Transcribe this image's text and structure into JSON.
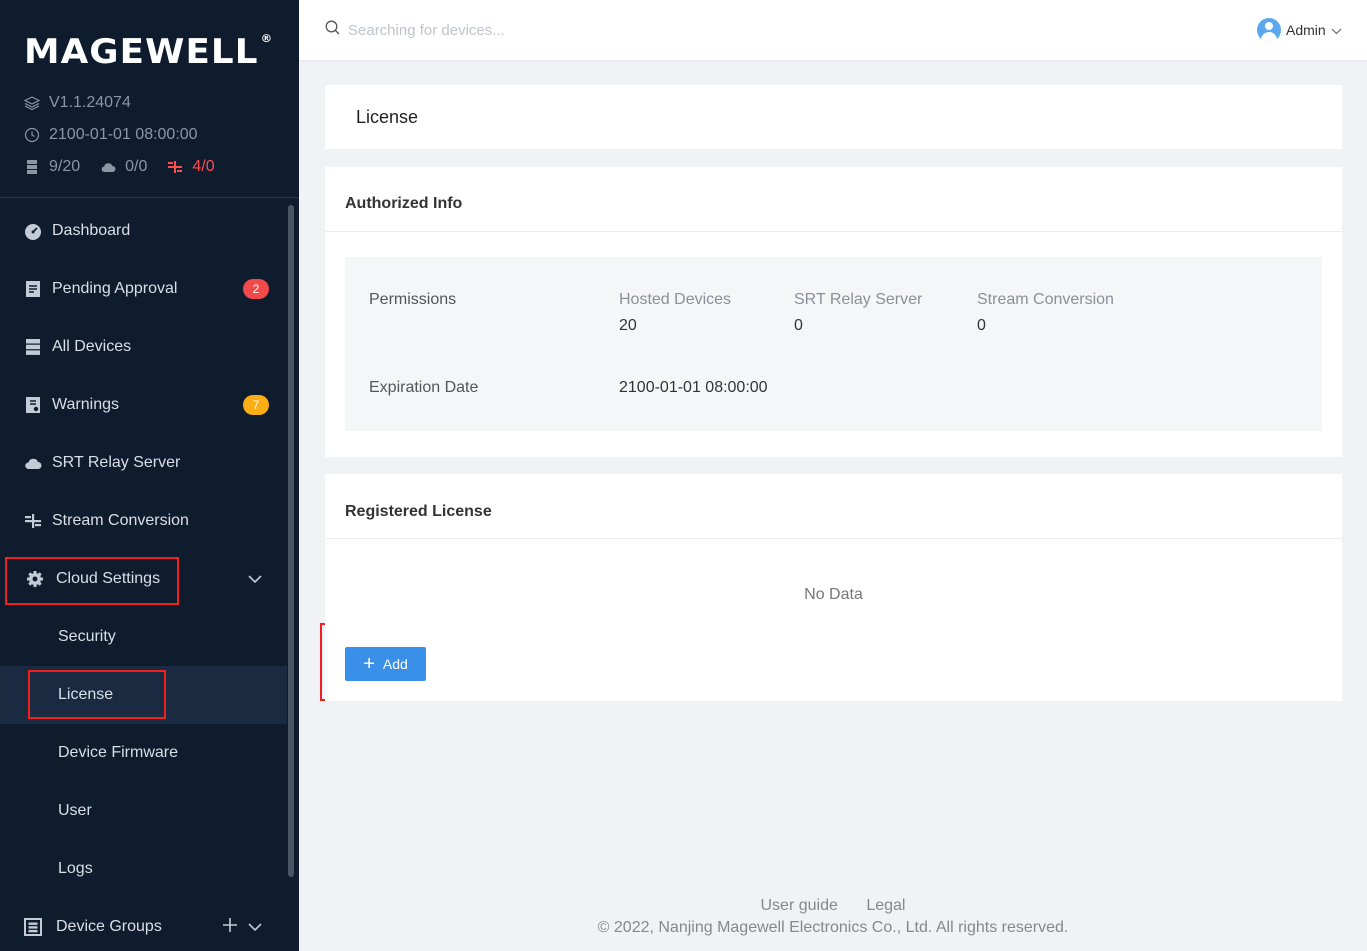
{
  "brand": {
    "logo": "MAGEWELL",
    "reg": "®"
  },
  "meta": {
    "version": "V1.1.24074",
    "datetime": "2100-01-01 08:00:00",
    "devices": "9/20",
    "cloud": "0/0",
    "streams": "4/0"
  },
  "sidebar": {
    "items": [
      {
        "label": "Dashboard"
      },
      {
        "label": "Pending Approval",
        "badge": "2"
      },
      {
        "label": "All Devices"
      },
      {
        "label": "Warnings",
        "badge": "7"
      },
      {
        "label": "SRT Relay Server"
      },
      {
        "label": "Stream Conversion"
      },
      {
        "label": "Cloud Settings"
      }
    ],
    "sub_items": [
      {
        "label": "Security"
      },
      {
        "label": "License"
      },
      {
        "label": "Device Firmware"
      },
      {
        "label": "User"
      },
      {
        "label": "Logs"
      }
    ],
    "groups_label": "Device Groups"
  },
  "header": {
    "search_placeholder": "Searching for devices...",
    "user": "Admin"
  },
  "page": {
    "title": "License",
    "authorized": {
      "title": "Authorized Info",
      "permissions_label": "Permissions",
      "columns": [
        {
          "header": "Hosted Devices",
          "value": "20"
        },
        {
          "header": "SRT Relay Server",
          "value": "0"
        },
        {
          "header": "Stream Conversion",
          "value": "0"
        }
      ],
      "expiration_label": "Expiration Date",
      "expiration_value": "2100-01-01 08:00:00"
    },
    "registered": {
      "title": "Registered License",
      "empty": "No Data",
      "add_label": "Add"
    }
  },
  "footer": {
    "guide": "User guide",
    "legal": "Legal",
    "copyright": "© 2022, Nanjing Magewell Electronics Co., Ltd. All rights reserved."
  },
  "colors": {
    "sidebar_bg": "#0f1c2e",
    "accent": "#3a8fe8",
    "highlight_box": "#f21f1f",
    "badge_red": "#f24a4a",
    "badge_yellow": "#faad14"
  }
}
